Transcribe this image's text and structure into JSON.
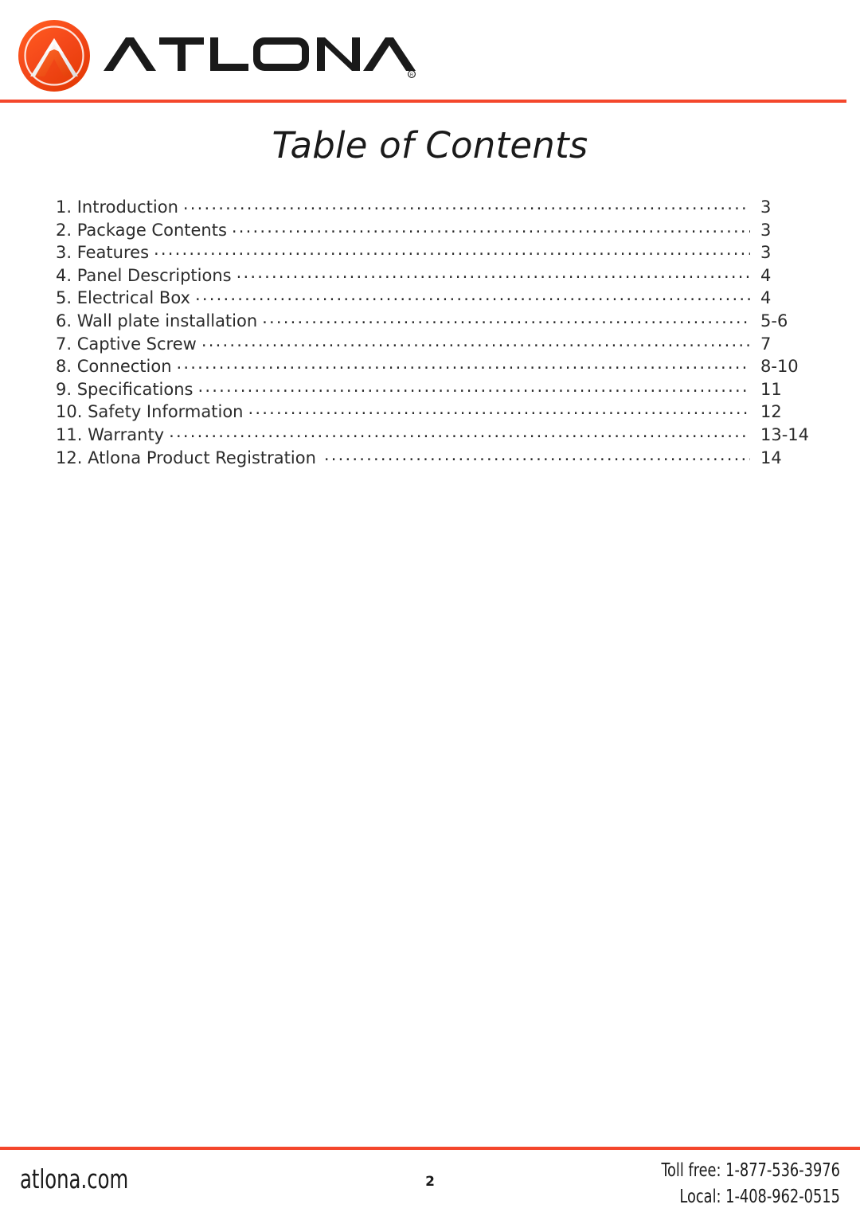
{
  "header": {
    "brand_name": "ATLONA",
    "brand_registered_mark": "®",
    "logo_icon": "atlona-chevron-circle-logo",
    "rule_color": "#f4472c",
    "orange": "#f4511e",
    "orange_dark": "#e03c00"
  },
  "page": {
    "title": "Table of Contents"
  },
  "toc": {
    "entries": [
      {
        "label": "1. Introduction",
        "page": "3"
      },
      {
        "label": "2. Package Contents",
        "page": "3"
      },
      {
        "label": "3. Features",
        "page": "3"
      },
      {
        "label": "4. Panel Descriptions",
        "page": "4"
      },
      {
        "label": "5. Electrical Box",
        "page": "4"
      },
      {
        "label": "6. Wall plate installation",
        "page": "5-6"
      },
      {
        "label": "7. Captive Screw",
        "page": "7"
      },
      {
        "label": "8. Connection",
        "page": "8-10"
      },
      {
        "label": "9. Specifications",
        "page": "11"
      },
      {
        "label": "10. Safety Information",
        "page": "12"
      },
      {
        "label": "11. Warranty",
        "page": "13-14"
      },
      {
        "label": "12. Atlona Product Registration",
        "page": "14"
      }
    ]
  },
  "footer": {
    "website": "atlona.com",
    "page_number": "2",
    "toll_free": "Toll free: 1-877-536-3976",
    "local": "Local: 1-408-962-0515"
  }
}
